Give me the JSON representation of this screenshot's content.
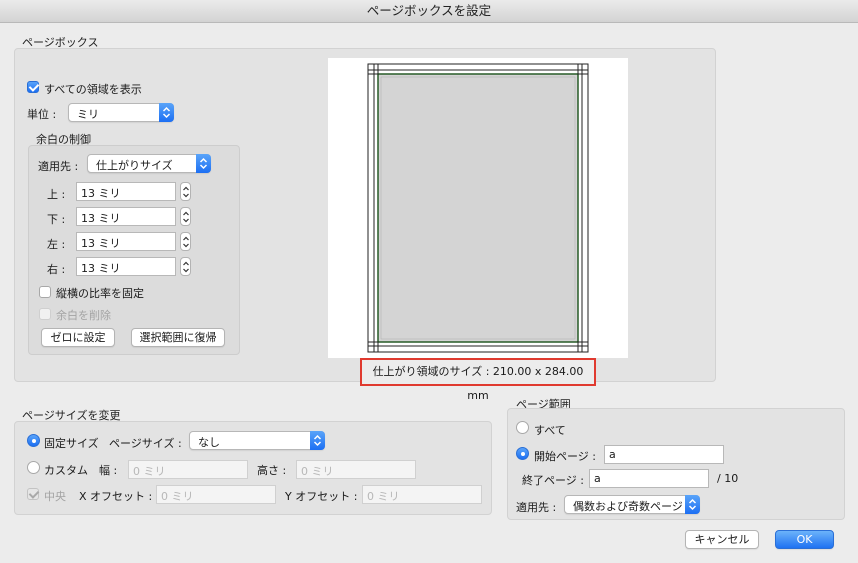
{
  "window": {
    "title": "ページボックスを設定"
  },
  "page_box": {
    "section_label": "ページボックス",
    "show_all_areas": {
      "label": "すべての領域を表示",
      "checked": true
    },
    "unit": {
      "label": "単位 :",
      "value": "ミリ"
    },
    "margin_control": {
      "section_label": "余白の制御",
      "apply_to": {
        "label": "適用先 :",
        "value": "仕上がりサイズ"
      },
      "top": {
        "label": "上 :",
        "value": "13 ミリ"
      },
      "bottom": {
        "label": "下 :",
        "value": "13 ミリ"
      },
      "left": {
        "label": "左 :",
        "value": "13 ミリ"
      },
      "right": {
        "label": "右 :",
        "value": "13 ミリ"
      },
      "constrain_proportions": {
        "label": "縦横の比率を固定",
        "checked": false
      },
      "remove_white_margins": {
        "label": "余白を削除",
        "checked": false,
        "disabled": true
      },
      "set_to_zero": "ゼロに設定",
      "revert_to_selection": "選択範囲に復帰"
    },
    "trim_size_readout": "仕上がり領域のサイズ : 210.00 x 284.00 mm",
    "preview_colors": {
      "trim_box": "#33cc33",
      "page_fill": "#d4d4d4"
    }
  },
  "change_page_size": {
    "section_label": "ページサイズを変更",
    "fixed_size": {
      "label": "固定サイズ",
      "selected": true
    },
    "page_size": {
      "label": "ページサイズ :",
      "value": "なし"
    },
    "custom": {
      "label": "カスタム",
      "selected": false
    },
    "width": {
      "label": "幅 :",
      "placeholder": "0 ミリ"
    },
    "height": {
      "label": "高さ :",
      "placeholder": "0 ミリ"
    },
    "center": {
      "label": "中央",
      "checked": true,
      "disabled": true
    },
    "x_offset": {
      "label": "X オフセット :",
      "placeholder": "0 ミリ"
    },
    "y_offset": {
      "label": "Y オフセット :",
      "placeholder": "0 ミリ"
    }
  },
  "page_range": {
    "section_label": "ページ範囲",
    "all": {
      "label": "すべて",
      "selected": false
    },
    "from": {
      "label": "開始ページ :",
      "value": "a",
      "selected": true
    },
    "to": {
      "label": "終了ページ :",
      "value": "a"
    },
    "total": "/ 10",
    "apply_to": {
      "label": "適用先 :",
      "value": "偶数および奇数ページ"
    }
  },
  "buttons": {
    "cancel": "キャンセル",
    "ok": "OK"
  },
  "colors": {
    "accent": "#1c6ff3",
    "highlight_border": "#e03a2f"
  }
}
